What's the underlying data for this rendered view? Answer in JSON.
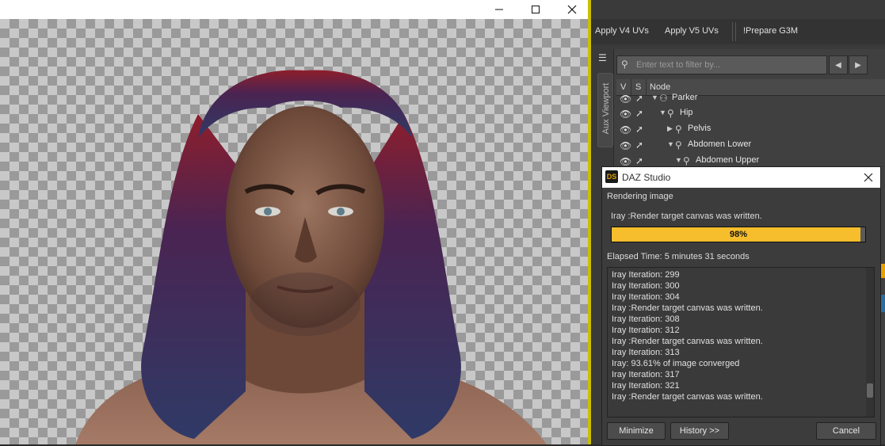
{
  "render_window": {
    "titlebar_buttons": [
      "minimize",
      "maximize",
      "close"
    ],
    "image_alt": "Rendered portrait of a man with long dark blue hair and red-tinted roots on a transparent checkerboard background"
  },
  "toolbar": {
    "apply_v4": "Apply V4 UVs",
    "apply_v5": "Apply V5 UVs",
    "prepare_g3m": "!Prepare G3M"
  },
  "scene_panel": {
    "side_tab": "Aux Viewport",
    "filter_placeholder": "Enter text to filter by...",
    "columns": [
      "V",
      "S",
      "Node"
    ],
    "nodes": [
      {
        "label": "Parker",
        "twist": "▼",
        "icon": "figure-icon"
      },
      {
        "label": "Hip",
        "twist": "▼",
        "icon": "bone-icon"
      },
      {
        "label": "Pelvis",
        "twist": "▶",
        "icon": "bone-icon"
      },
      {
        "label": "Abdomen Lower",
        "twist": "▼",
        "icon": "bone-icon"
      },
      {
        "label": "Abdomen Upper",
        "twist": "▼",
        "icon": "bone-icon"
      }
    ]
  },
  "dialog": {
    "title": "DAZ Studio",
    "heading": "Rendering image",
    "status": "Iray :Render target canvas was written.",
    "progress_percent": 98,
    "progress_text": "98%",
    "elapsed": "Elapsed Time:  5 minutes 31 seconds",
    "log": [
      "Iray Iteration: 299",
      "Iray Iteration: 300",
      "Iray Iteration: 304",
      "Iray :Render target canvas was written.",
      "Iray Iteration: 308",
      "Iray Iteration: 312",
      "Iray :Render target canvas was written.",
      "Iray Iteration: 313",
      "Iray: 93.61% of image converged",
      "Iray Iteration: 317",
      "Iray Iteration: 321",
      "Iray :Render target canvas was written."
    ],
    "buttons": {
      "minimize": "Minimize",
      "history": "History >>",
      "cancel": "Cancel"
    }
  },
  "colors": {
    "progress_fill": "#f6be2d",
    "frame_edge": "#c8c000"
  }
}
